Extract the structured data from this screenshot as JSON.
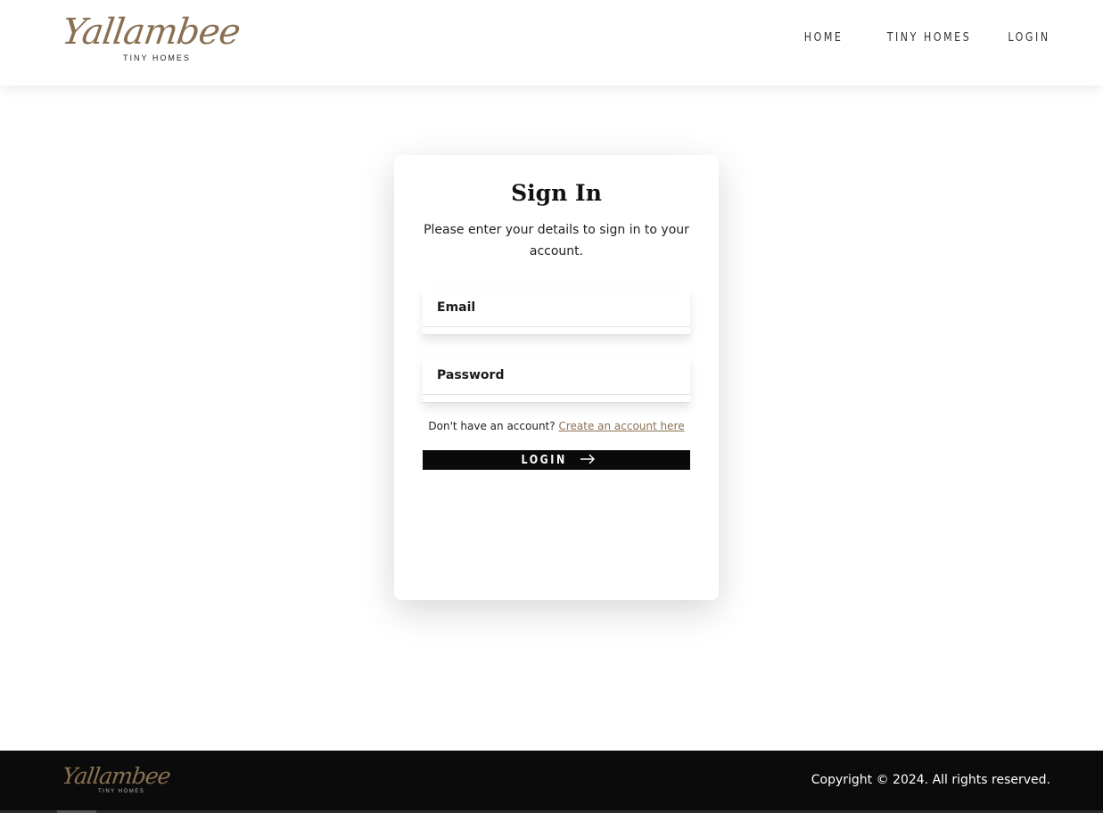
{
  "header": {
    "logo_script": "Yallambee",
    "logo_sub": "TINY HOMES",
    "nav": [
      "HOME",
      "TINY HOMES",
      "LOGIN"
    ]
  },
  "signin": {
    "title": "Sign In",
    "subtitle": "Please enter your details to sign in to your account.",
    "email_placeholder": "Email",
    "password_placeholder": "Password",
    "no_account_text": "Don't have an account?",
    "create_account_link": "Create an account here",
    "login_button": "LOGIN",
    "login_icon": "arrow-right-icon"
  },
  "footer": {
    "logo_script": "Yallambee",
    "logo_sub": "TINY HOMES",
    "copyright": "Copyright © 2024. All rights reserved."
  },
  "colors": {
    "brand": "#8a7052",
    "dark": "#0b0b0b"
  }
}
